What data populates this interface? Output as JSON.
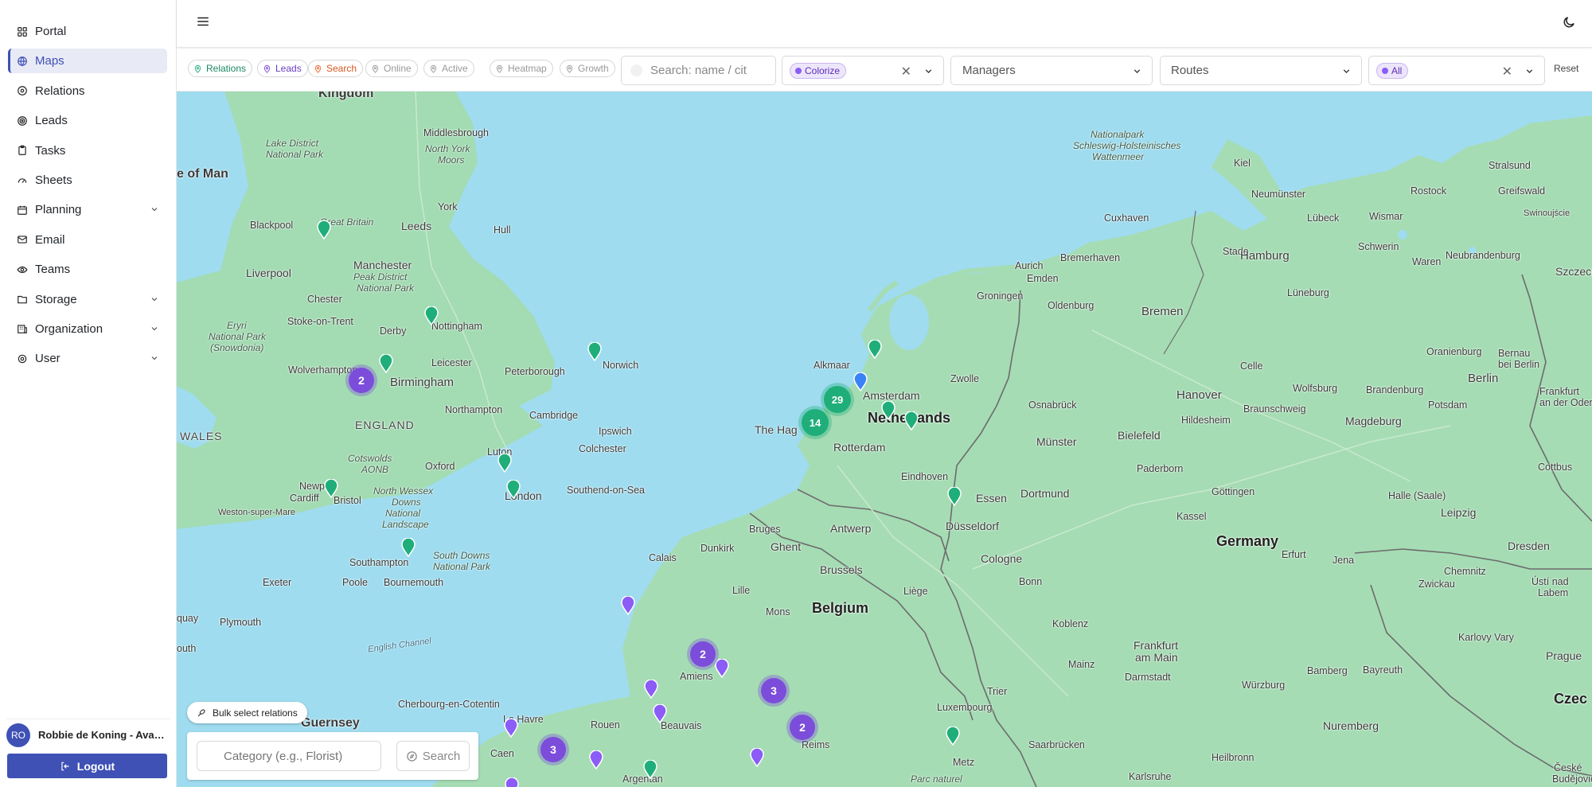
{
  "sidebar": {
    "items": [
      {
        "label": "Portal",
        "icon": "grid-icon"
      },
      {
        "label": "Maps",
        "icon": "globe-icon"
      },
      {
        "label": "Relations",
        "icon": "users-icon"
      },
      {
        "label": "Leads",
        "icon": "target-icon"
      },
      {
        "label": "Tasks",
        "icon": "clipboard-icon"
      },
      {
        "label": "Sheets",
        "icon": "gauge-icon"
      },
      {
        "label": "Planning",
        "icon": "calendar-icon"
      },
      {
        "label": "Email",
        "icon": "mail-icon"
      },
      {
        "label": "Teams",
        "icon": "team-icon"
      },
      {
        "label": "Storage",
        "icon": "folder-icon"
      },
      {
        "label": "Organization",
        "icon": "building-icon"
      },
      {
        "label": "User",
        "icon": "settings-icon"
      }
    ],
    "active": "Maps",
    "user": {
      "initials": "RO",
      "name": "Robbie de Koning - Avant..."
    },
    "logout_label": "Logout"
  },
  "filters": {
    "chips": [
      {
        "label": "Relations",
        "color": "#1fae7a"
      },
      {
        "label": "Leads",
        "color": "#7c4ddb"
      },
      {
        "label": "Search",
        "color": "#e8672c"
      },
      {
        "label": "Online",
        "color": "#9a9a9a"
      },
      {
        "label": "Active",
        "color": "#9a9a9a"
      },
      {
        "label": "Heatmap",
        "color": "#9a9a9a"
      },
      {
        "label": "Growth",
        "color": "#9a9a9a"
      }
    ],
    "search_placeholder": "Search: name / cit",
    "colorize_tag": "Colorize",
    "managers_placeholder": "Managers",
    "routes_placeholder": "Routes",
    "status_tag": "All",
    "reset_label": "Reset"
  },
  "map": {
    "labels": {
      "kingdom": "Kingdom",
      "isle_of_man": "e of Man",
      "middlesbrough": "Middlesbrough",
      "lake_district": "Lake District",
      "national_park": "National Park",
      "north_york": "North York",
      "moors": "Moors",
      "york": "York",
      "great_britain": "Great Britain",
      "leeds": "Leeds",
      "hull": "Hull",
      "blackpool": "Blackpool",
      "liverpool": "Liverpool",
      "manchester": "Manchester",
      "peak": "Peak District",
      "peak2": "National Park",
      "chester": "Chester",
      "stoke": "Stoke-on-Trent",
      "derby": "Derby",
      "nottingham": "Nottingham",
      "eryri": "Eryri",
      "eryri2": "National Park",
      "eryri3": "(Snowdonia)",
      "wolverhampton": "Wolverhampton",
      "birmingham": "Birmingham",
      "leicester": "Leicester",
      "peterborough": "Peterborough",
      "norwich": "Norwich",
      "england": "ENGLAND",
      "northampton": "Northampton",
      "cambridge": "Cambridge",
      "ipswich": "Ipswich",
      "wales": "WALES",
      "cotswolds": "Cotswolds",
      "aonb": "AONB",
      "oxford": "Oxford",
      "colchester": "Colchester",
      "luton": "Luton",
      "newport": "Newport",
      "cardiff": "Cardiff",
      "bristol": "Bristol",
      "london": "London",
      "southend": "Southend-on-Sea",
      "nwd1": "North Wessex",
      "nwd2": "Downs",
      "nwd3": "National",
      "nwd4": "Landscape",
      "weston": "Weston-super-Mare",
      "southampton": "Southampton",
      "sdowns1": "South Downs",
      "sdowns2": "National Park",
      "exeter": "Exeter",
      "poole": "Poole",
      "bournemouth": "Bournemouth",
      "plymouth": "Plymouth",
      "quay": "quay",
      "english_channel": "English Channel",
      "outh": "outh",
      "guernsey": "Guernsey",
      "cherbourg": "Cherbourg-en-Cotentin",
      "le_havre": "Le Havre",
      "caen": "Caen",
      "rouen": "Rouen",
      "argentan": "Argentan",
      "calais": "Calais",
      "dunkirk": "Dunkirk",
      "bruges": "Bruges",
      "ghent": "Ghent",
      "antwerp": "Antwerp",
      "brussels": "Brussels",
      "lille": "Lille",
      "mons": "Mons",
      "belgium": "Belgium",
      "liege": "Liège",
      "amiens": "Amiens",
      "beauvais": "Beauvais",
      "reims": "Reims",
      "luxembourg": "Luxembourg",
      "metz": "Metz",
      "trier": "Trier",
      "saarbrucken": "Saarbrücken",
      "parc": "Parc naturel",
      "alkmaar": "Alkmaar",
      "amsterdam": "Amsterdam",
      "the_hague": "The Hag",
      "rotterdam": "Rotterdam",
      "netherlands": "Netherlands",
      "zwolle": "Zwolle",
      "eindhoven": "Eindhoven",
      "groningen": "Groningen",
      "oldenburg": "Oldenburg",
      "bremen": "Bremen",
      "bremerhaven": "Bremerhaven",
      "emden": "Emden",
      "aurich": "Aurich",
      "cuxhaven": "Cuxhaven",
      "stade": "Stade",
      "hamburg": "Hamburg",
      "neumunster": "Neumünster",
      "kiel": "Kiel",
      "lubeck": "Lübeck",
      "wismar": "Wismar",
      "rostock": "Rostock",
      "stralsund": "Stralsund",
      "greifswald": "Greifswald",
      "schwerin": "Schwerin",
      "swinoujscie": "Swinoujście",
      "szczecin": "Szczeci",
      "neubrandenburg": "Neubrandenburg",
      "waren": "Waren",
      "luneburg": "Lüneburg",
      "celle": "Celle",
      "hanover": "Hanover",
      "wolfsburg": "Wolfsburg",
      "brandenburg": "Brandenburg",
      "oranienburg": "Oranienburg",
      "berlin": "Berlin",
      "frankfurt_oder": "Frankfurt",
      "frankfurt_oder2": "an der Oder",
      "potsdam": "Potsdam",
      "bernau": "Bernau",
      "bernau2": "bei Berlin",
      "osnabruck": "Osnabrück",
      "bielefeld": "Bielefeld",
      "hildesheim": "Hildesheim",
      "braunschweig": "Braunschweig",
      "magdeburg": "Magdeburg",
      "munster": "Münster",
      "paderborn": "Paderborn",
      "essen": "Essen",
      "dortmund": "Dortmund",
      "dusseldorf": "Düsseldorf",
      "gottingen": "Göttingen",
      "halle": "Halle (Saale)",
      "leipzig": "Leipzig",
      "cottbus": "Cottbus",
      "kassel": "Kassel",
      "germany": "Germany",
      "cologne": "Cologne",
      "bonn": "Bonn",
      "erfurt": "Erfurt",
      "jena": "Jena",
      "dresden": "Dresden",
      "chemnitz": "Chemnitz",
      "zwickau": "Zwickau",
      "usti": "Ústí nad",
      "usti2": "Labem",
      "koblenz": "Koblenz",
      "frankfurt": "Frankfurt",
      "frankfurt2": "am Main",
      "mainz": "Mainz",
      "darmstadt": "Darmstadt",
      "wurzburg": "Würzburg",
      "bamberg": "Bamberg",
      "bayreuth": "Bayreuth",
      "karlovy": "Karlovy Vary",
      "prague": "Prague",
      "nuremberg": "Nuremberg",
      "heilbronn": "Heilbronn",
      "karlsruhe": "Karlsruhe",
      "czech": "Czec",
      "ceske": "České",
      "ceske2": "Budějovic",
      "npsh1": "Nationalpark",
      "npsh2": "Schleswig-Holsteinisches",
      "npsh3": "Wattenmeer"
    },
    "clusters": [
      {
        "count": "2",
        "color": "purple"
      },
      {
        "count": "29",
        "color": "green"
      },
      {
        "count": "14",
        "color": "green"
      },
      {
        "count": "2",
        "color": "purple"
      },
      {
        "count": "3",
        "color": "purple"
      },
      {
        "count": "2",
        "color": "purple"
      },
      {
        "count": "3",
        "color": "purple"
      }
    ]
  },
  "bulk_select_label": "Bulk select relations",
  "category": {
    "placeholder": "Category (e.g., Florist)",
    "search_label": "Search"
  }
}
